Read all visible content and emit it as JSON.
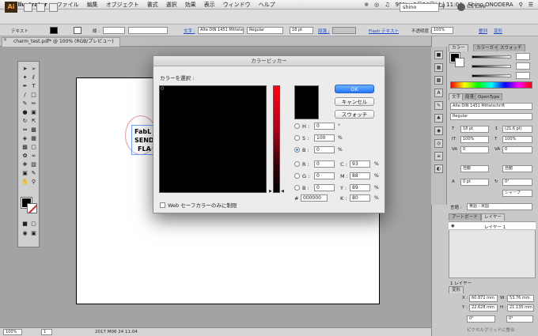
{
  "menubar": {
    "app_name": "Illustrator",
    "items": [
      "ファイル",
      "編集",
      "オブジェクト",
      "書式",
      "選択",
      "効果",
      "表示",
      "ウィンドウ",
      "ヘルプ"
    ],
    "battery": "99%",
    "clock": "6月24日(土) 11:04",
    "user": "Shino ONODERA"
  },
  "approw": {
    "logo": "Ai",
    "workspace": "shino",
    "cs_live": "CS Live"
  },
  "control_bar": {
    "object_type": "テキスト",
    "stroke_label": "線 :",
    "char_link": "文字 :",
    "font": "Alte DIN 1451 Mittelsch",
    "style": "Regular",
    "size": "18 pt",
    "para_link": "段落 :",
    "flash_link": "Flash テキスト",
    "opacity_label": "不透明度 :",
    "opacity": "100%",
    "shape_link": "整列",
    "transform_link": "変形"
  },
  "document": {
    "tab_title": "charm_test.pdf* @ 100% (RGB/プレビュー)",
    "text_line1": "FabL",
    "text_line2": "SEND",
    "text_line3": "FLA"
  },
  "status_bar": {
    "zoom": "100%",
    "page": "1",
    "date": "2017 M06 24 11:04"
  },
  "color_picker": {
    "title": "カラーピッカー",
    "select_label": "カラーを選択 :",
    "ok_label": "OK",
    "cancel_label": "キャンセル",
    "swatches_label": "スウォッチ",
    "websafe_label": "Web セーフカラーのみに制限",
    "hsb": [
      {
        "label": "H :",
        "value": "0",
        "unit": "°",
        "selected": false
      },
      {
        "label": "S :",
        "value": "100",
        "unit": "%",
        "selected": false
      },
      {
        "label": "B :",
        "value": "0",
        "unit": "%",
        "selected": true
      }
    ],
    "rgb": [
      {
        "label": "R :",
        "value": "0"
      },
      {
        "label": "G :",
        "value": "0"
      },
      {
        "label": "B :",
        "value": "0"
      }
    ],
    "hex_label": "#",
    "hex": "000000",
    "cmyk": [
      {
        "label": "C :",
        "value": "93",
        "unit": "%"
      },
      {
        "label": "M :",
        "value": "88",
        "unit": "%"
      },
      {
        "label": "Y :",
        "value": "89",
        "unit": "%"
      },
      {
        "label": "K :",
        "value": "80",
        "unit": "%"
      }
    ]
  },
  "panels": {
    "color_tab": "カラー",
    "color_guide_tab": "カラーガイド",
    "swatch_tab": "スウォッチ",
    "char_tab": "文字",
    "para_tab": "段落",
    "opentype_tab": "OpenType",
    "font": "Alte DIN 1451 Mittelschrift",
    "font_style": "Regular",
    "size": "18 pt",
    "leading": "(21.6 pt)",
    "hscale": "100%",
    "vscale": "100%",
    "tracking": "0",
    "kerning": "0",
    "auto1": "自動",
    "auto2": "自動",
    "baseline": "0 pt",
    "rotation": "0°",
    "sharp": "シャープ",
    "language_label": "言語 :",
    "language": "英語 : 米国",
    "artboard_tab": "アートボード",
    "layer_tab": "レイヤー",
    "layer_name": "レイヤー 1",
    "layer_count": "1 レイヤー",
    "transform_tab": "変形",
    "x_label": "X :",
    "x": "60.872 mm",
    "y_label": "Y :",
    "y": "22.628 mm",
    "w_label": "W :",
    "w": "53.76 mm",
    "h_label": "H :",
    "h": "21.135 mm",
    "angle1": "0°",
    "angle2": "0°",
    "pixel_grid": "ピクセルグリッドに整合"
  },
  "colors": {
    "ok_blue": "#2677ff",
    "hue_red": "#ff0012",
    "link_blue": "#1a46c8"
  }
}
